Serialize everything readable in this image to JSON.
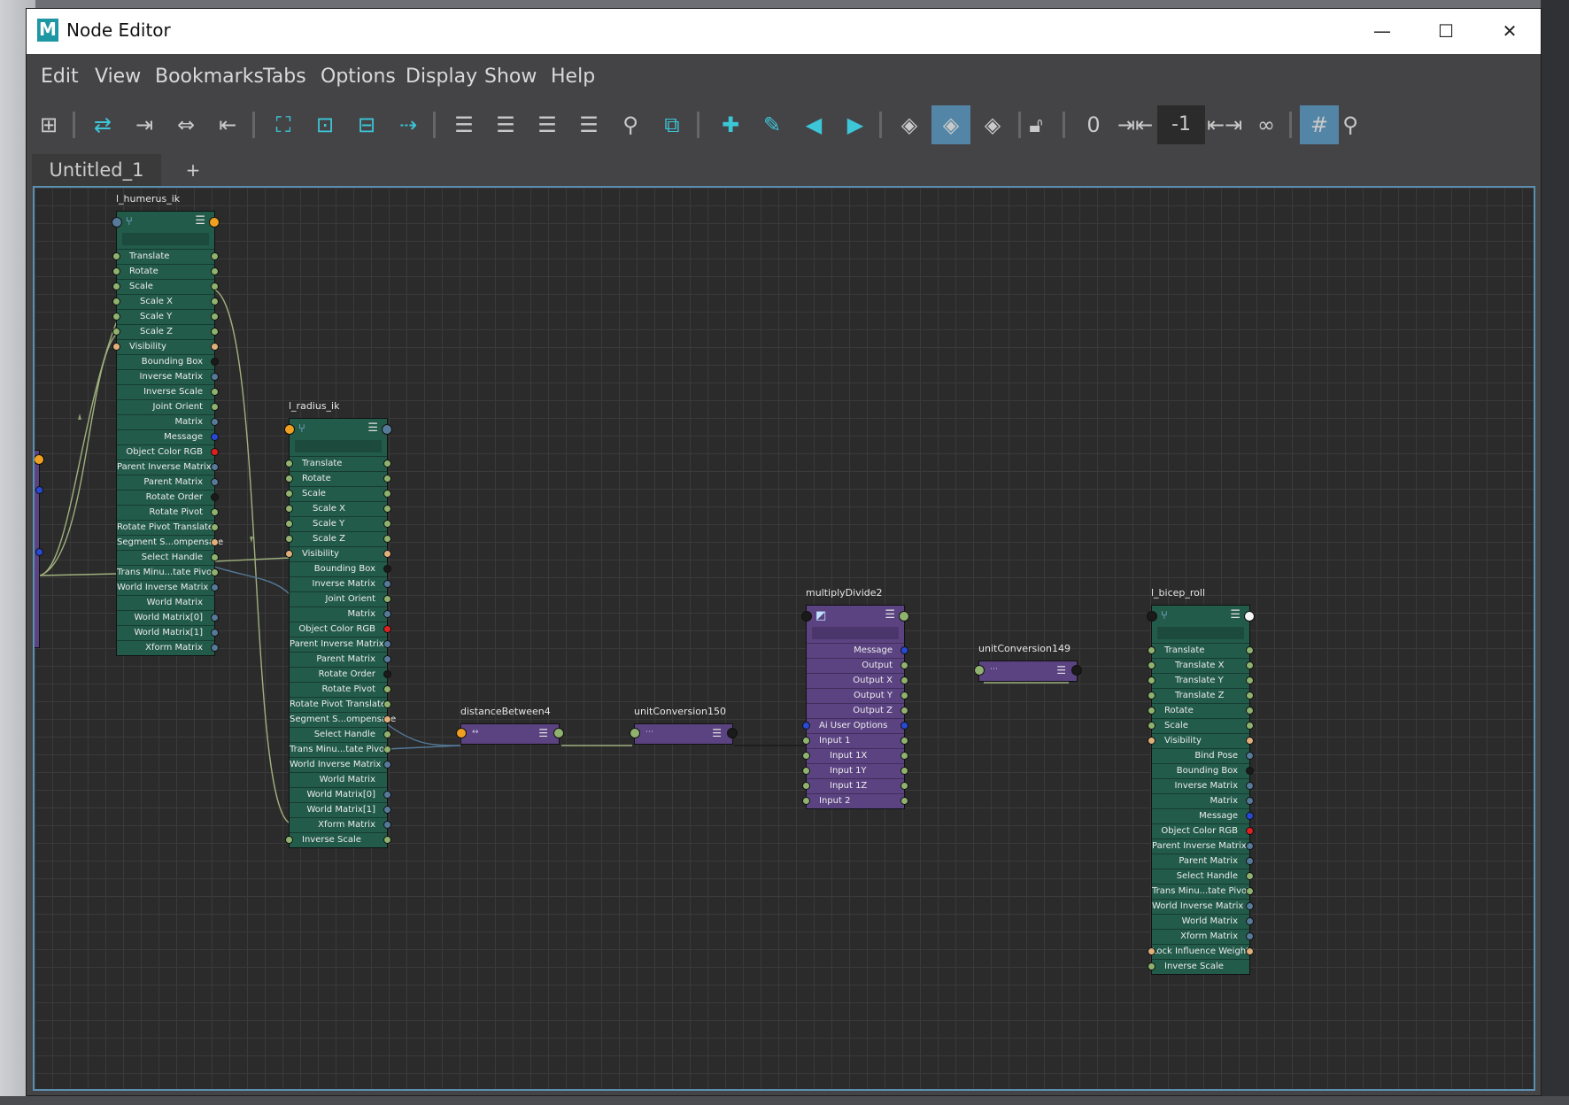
{
  "window": {
    "app_logo": "M",
    "title": "Node Editor",
    "controls": {
      "minimize": "—",
      "maximize": "☐",
      "close": "✕"
    }
  },
  "menu": [
    "Edit",
    "View",
    "Bookmarks",
    "Tabs",
    "Options",
    "Display",
    "Show",
    "Help"
  ],
  "toolbar": {
    "icons": [
      "add-node-icon",
      "swap-graph-icon",
      "input-connections-icon",
      "in-out-connections-icon",
      "output-connections-icon",
      "frame-all-icon",
      "frame-selected-icon",
      "remove-selected-icon",
      "pin-selected-icon",
      "simple-layout-icon",
      "connected-layout-icon",
      "full-layout-icon",
      "custom-layout-icon",
      "search-icon",
      "fit-graph-icon",
      "bookmark-add-icon",
      "bookmark-edit-icon",
      "bookmark-prev-icon",
      "bookmark-next-icon",
      "graph-materials-icon",
      "graph-selected-icon",
      "graph-clear-icon",
      "lock-icon",
      "spacing-zero-icon",
      "reduce-spacing-icon",
      "increase-spacing-icon",
      "link-icon",
      "grid-toggle-icon",
      "search-right-icon"
    ],
    "value_zero": "0",
    "value_minus_one": "-1",
    "active_color": "#5285a6"
  },
  "tabs": {
    "current": "Untitled_1",
    "add": "+"
  },
  "colors": {
    "green_node": "#235b4a",
    "purple_node": "#5b4382",
    "canvas": "#2b2b2b",
    "wire": "#a0b07e"
  },
  "nodes": {
    "humerus": {
      "name": "l_humerus_ik",
      "attrs": [
        "Translate",
        "Rotate",
        "Scale",
        "Scale X",
        "Scale Y",
        "Scale Z",
        "Visibility",
        "Bounding Box",
        "Inverse Matrix",
        "Inverse Scale",
        "Joint Orient",
        "Matrix",
        "Message",
        "Object Color RGB",
        "Parent Inverse Matrix",
        "Parent Matrix",
        "Rotate Order",
        "Rotate Pivot",
        "Rotate Pivot Translate",
        "Segment S...ompensate",
        "Select Handle",
        "Trans Minu...tate Pivot",
        "World Inverse Matrix",
        "World Matrix",
        "World Matrix[0]",
        "World Matrix[1]",
        "Xform Matrix"
      ]
    },
    "radius": {
      "name": "l_radius_ik",
      "attrs": [
        "Translate",
        "Rotate",
        "Scale",
        "Scale X",
        "Scale Y",
        "Scale Z",
        "Visibility",
        "Bounding Box",
        "Inverse Matrix",
        "Joint Orient",
        "Matrix",
        "Object Color RGB",
        "Parent Inverse Matrix",
        "Parent Matrix",
        "Rotate Order",
        "Rotate Pivot",
        "Rotate Pivot Translate",
        "Segment S...ompensate",
        "Select Handle",
        "Trans Minu...tate Pivot",
        "World Inverse Matrix",
        "World Matrix",
        "World Matrix[0]",
        "World Matrix[1]",
        "Xform Matrix",
        "Inverse Scale"
      ]
    },
    "distance": {
      "name": "distanceBetween4"
    },
    "uc150": {
      "name": "unitConversion150"
    },
    "multiply": {
      "name": "multiplyDivide2",
      "attrs": [
        "Message",
        "Output",
        "Output X",
        "Output Y",
        "Output Z",
        "Ai User Options",
        "Input 1",
        "Input 1X",
        "Input 1Y",
        "Input 1Z",
        "Input 2"
      ]
    },
    "uc149": {
      "name": "unitConversion149"
    },
    "bicep": {
      "name": "l_bicep_roll",
      "attrs": [
        "Translate",
        "Translate X",
        "Translate Y",
        "Translate Z",
        "Rotate",
        "Scale",
        "Visibility",
        "Bind Pose",
        "Bounding Box",
        "Inverse Matrix",
        "Matrix",
        "Message",
        "Object Color RGB",
        "Parent Inverse Matrix",
        "Parent Matrix",
        "Select Handle",
        "Trans Minu...tate Pivot",
        "World Inverse Matrix",
        "World Matrix",
        "Xform Matrix",
        "Lock Influence Weights",
        "Inverse Scale"
      ]
    }
  }
}
